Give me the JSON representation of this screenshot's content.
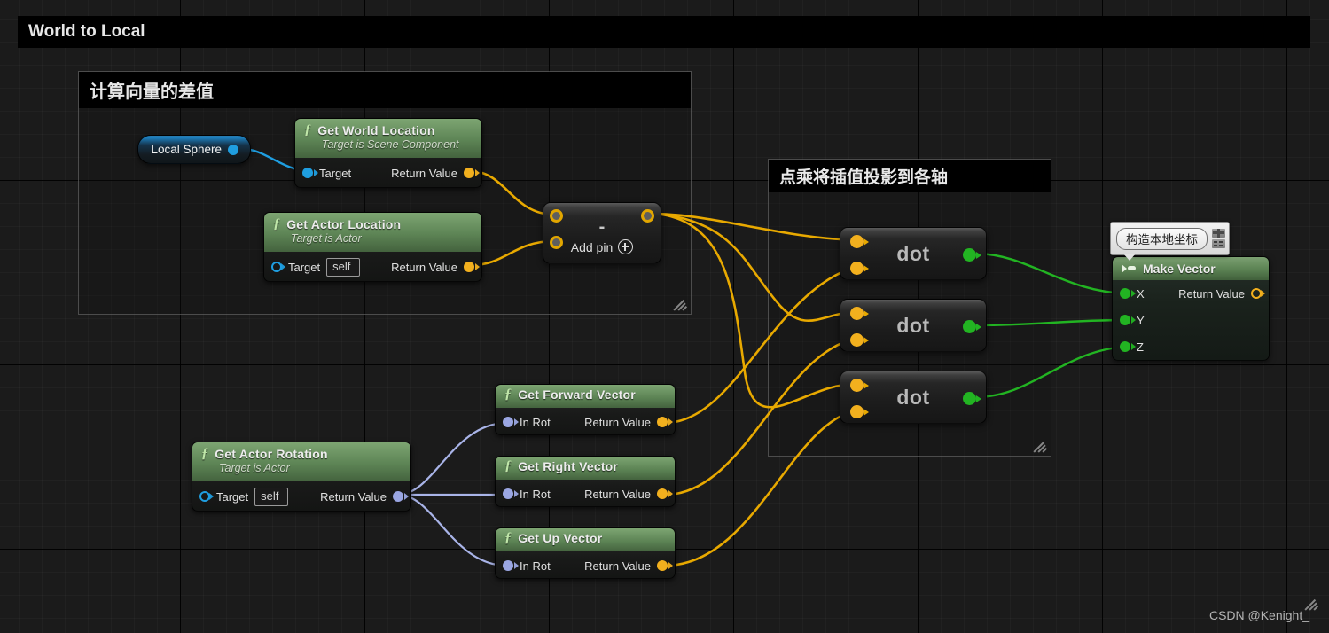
{
  "graph": {
    "title_comment": "World to Local",
    "watermark": "CSDN @Kenight_"
  },
  "comments": [
    {
      "id": "world-to-local",
      "label": "World to Local"
    },
    {
      "id": "vector-difference",
      "label": "计算向量的差值"
    },
    {
      "id": "dot-projection",
      "label": "点乘将插值投影到各轴"
    }
  ],
  "tooltip": {
    "text": "构造本地坐标",
    "pin_icon": "pin-icon",
    "list_icon": "list-icon"
  },
  "nodes": {
    "local_sphere": {
      "label": "Local Sphere",
      "pin_color": "#1f9ee0"
    },
    "get_world_location": {
      "title": "Get World Location",
      "subtitle": "Target is Scene Component",
      "input_label": "Target",
      "output_label": "Return Value"
    },
    "get_actor_location": {
      "title": "Get Actor Location",
      "subtitle": "Target is Actor",
      "input_label": "Target",
      "input_value": "self",
      "output_label": "Return Value"
    },
    "subtract": {
      "operator": "-",
      "add_pin_label": "Add pin",
      "add_pin_icon": "plus-circle-icon"
    },
    "dot_x": {
      "label": "dot"
    },
    "dot_y": {
      "label": "dot"
    },
    "dot_z": {
      "label": "dot"
    },
    "get_actor_rotation": {
      "title": "Get Actor Rotation",
      "subtitle": "Target is Actor",
      "input_label": "Target",
      "input_value": "self",
      "output_label": "Return Value"
    },
    "get_forward_vector": {
      "title": "Get Forward Vector",
      "input_label": "In Rot",
      "output_label": "Return Value"
    },
    "get_right_vector": {
      "title": "Get Right Vector",
      "input_label": "In Rot",
      "output_label": "Return Value"
    },
    "get_up_vector": {
      "title": "Get Up Vector",
      "input_label": "In Rot",
      "output_label": "Return Value"
    },
    "make_vector": {
      "title": "Make Vector",
      "inputs": [
        "X",
        "Y",
        "Z"
      ],
      "output_label": "Return Value"
    }
  },
  "colors": {
    "wire_vector": "#e8a900",
    "wire_float": "#22b422",
    "wire_object": "#1f9ee0",
    "wire_rotator": "#a9b4e8",
    "node_header_green": "#5d8455",
    "pin_vector": "#f2b01e",
    "pin_float": "#22b422",
    "pin_object": "#1f9ee0",
    "pin_rotator": "#9aa6e2",
    "background": "#1b1b1b"
  }
}
